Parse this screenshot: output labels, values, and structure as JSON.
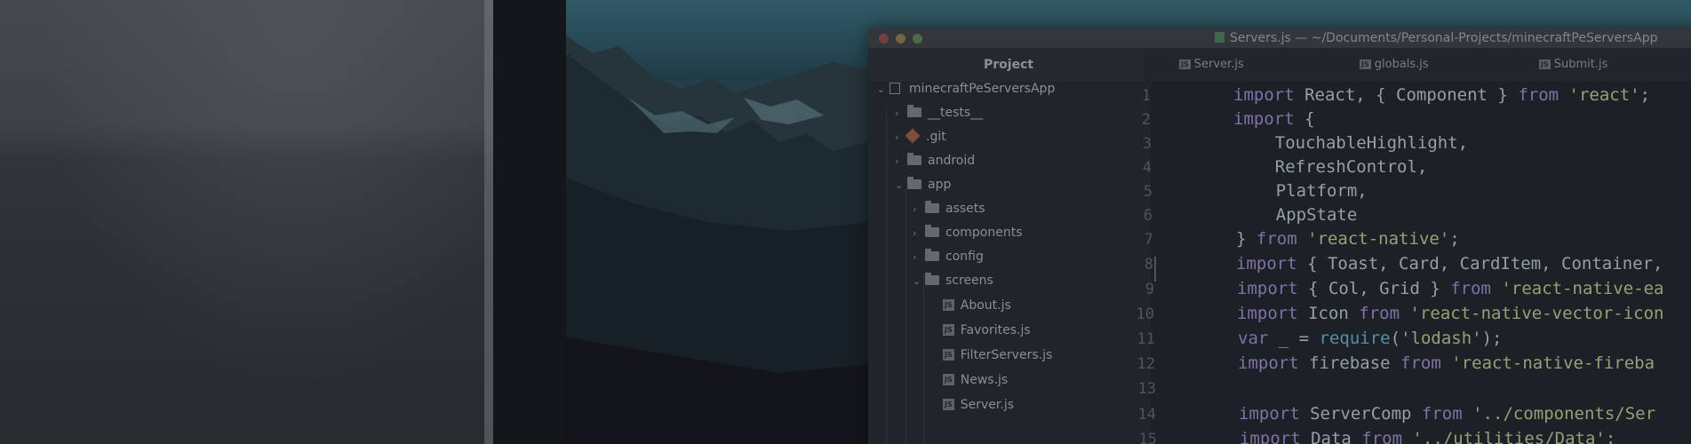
{
  "window": {
    "title": "Servers.js — ~/Documents/Personal-Projects/minecraftPeServersApp",
    "file_icon": "file-icon"
  },
  "project_panel": {
    "header": "Project",
    "root": "minecraftPeServersApp",
    "items": [
      {
        "label": "__tests__",
        "type": "folder",
        "expanded": false
      },
      {
        "label": ".git",
        "type": "git",
        "expanded": false
      },
      {
        "label": "android",
        "type": "folder",
        "expanded": false
      },
      {
        "label": "app",
        "type": "folder",
        "expanded": true
      },
      {
        "label": "assets",
        "type": "folder",
        "expanded": false
      },
      {
        "label": "components",
        "type": "folder",
        "expanded": false
      },
      {
        "label": "config",
        "type": "folder",
        "expanded": false
      },
      {
        "label": "screens",
        "type": "folder",
        "expanded": true
      },
      {
        "label": "About.js",
        "type": "file"
      },
      {
        "label": "Favorites.js",
        "type": "file"
      },
      {
        "label": "FilterServers.js",
        "type": "file"
      },
      {
        "label": "News.js",
        "type": "file"
      },
      {
        "label": "Server.js",
        "type": "file"
      }
    ]
  },
  "tabs": [
    {
      "label": "Server.js",
      "badge": "JS"
    },
    {
      "label": "globals.js",
      "badge": "JS"
    },
    {
      "label": "Submit.js",
      "badge": "JS"
    }
  ],
  "editor": {
    "line_numbers": [
      "1",
      "2",
      "3",
      "4",
      "5",
      "6",
      "7",
      "8",
      "9",
      "10",
      "11",
      "12",
      "13",
      "14",
      "15"
    ],
    "lines": [
      "import React, { Component } from 'react';",
      "import {",
      "    TouchableHighlight,",
      "    RefreshControl,",
      "    Platform,",
      "    AppState",
      "} from 'react-native';",
      "import { Toast, Card, CardItem, Container,",
      "import { Col, Grid } from 'react-native-ea",
      "import Icon from 'react-native-vector-icon",
      "var _ = require('lodash');",
      "import firebase from 'react-native-fireba",
      "",
      "import ServerComp from '../components/Ser",
      "import Data from '../utilities/Data';"
    ]
  }
}
